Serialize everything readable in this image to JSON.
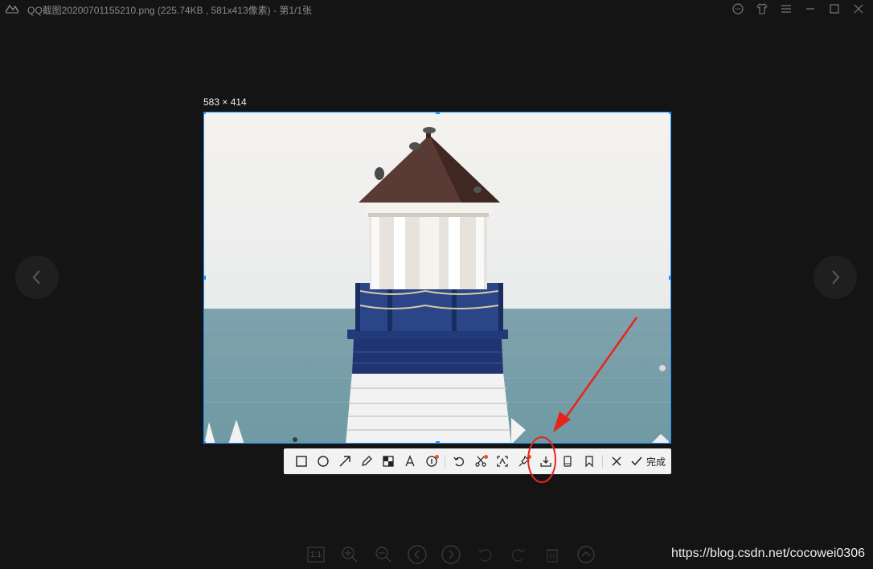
{
  "window": {
    "title": "QQ截图20200701155210.png (225.74KB , 581x413像素) - 第1/1张"
  },
  "title_icons": [
    "chat-bubble-icon",
    "tshirt-skin-icon",
    "menu-icon",
    "minimize-icon",
    "maximize-icon",
    "close-icon"
  ],
  "screenshot": {
    "dimensions_label": "583 × 414"
  },
  "toolbar": {
    "tools": [
      "rectangle-icon",
      "ellipse-icon",
      "arrow-icon",
      "pencil-icon",
      "mosaic-icon",
      "text-icon",
      "number-marker-icon",
      "undo-icon",
      "scissors-icon",
      "ocr-icon",
      "pin-icon",
      "download-save-icon",
      "phone-icon",
      "bookmark-icon",
      "cancel-icon"
    ],
    "finish_label": "完成"
  },
  "bottom_toolbar": {
    "actual_size_label": "1:1"
  },
  "watermark": "https://blog.csdn.net/cocowei0306",
  "colors": {
    "background": "#141414",
    "selection": "#1e90ff",
    "annotation": "#e8231c",
    "badge": "#e8541c"
  }
}
